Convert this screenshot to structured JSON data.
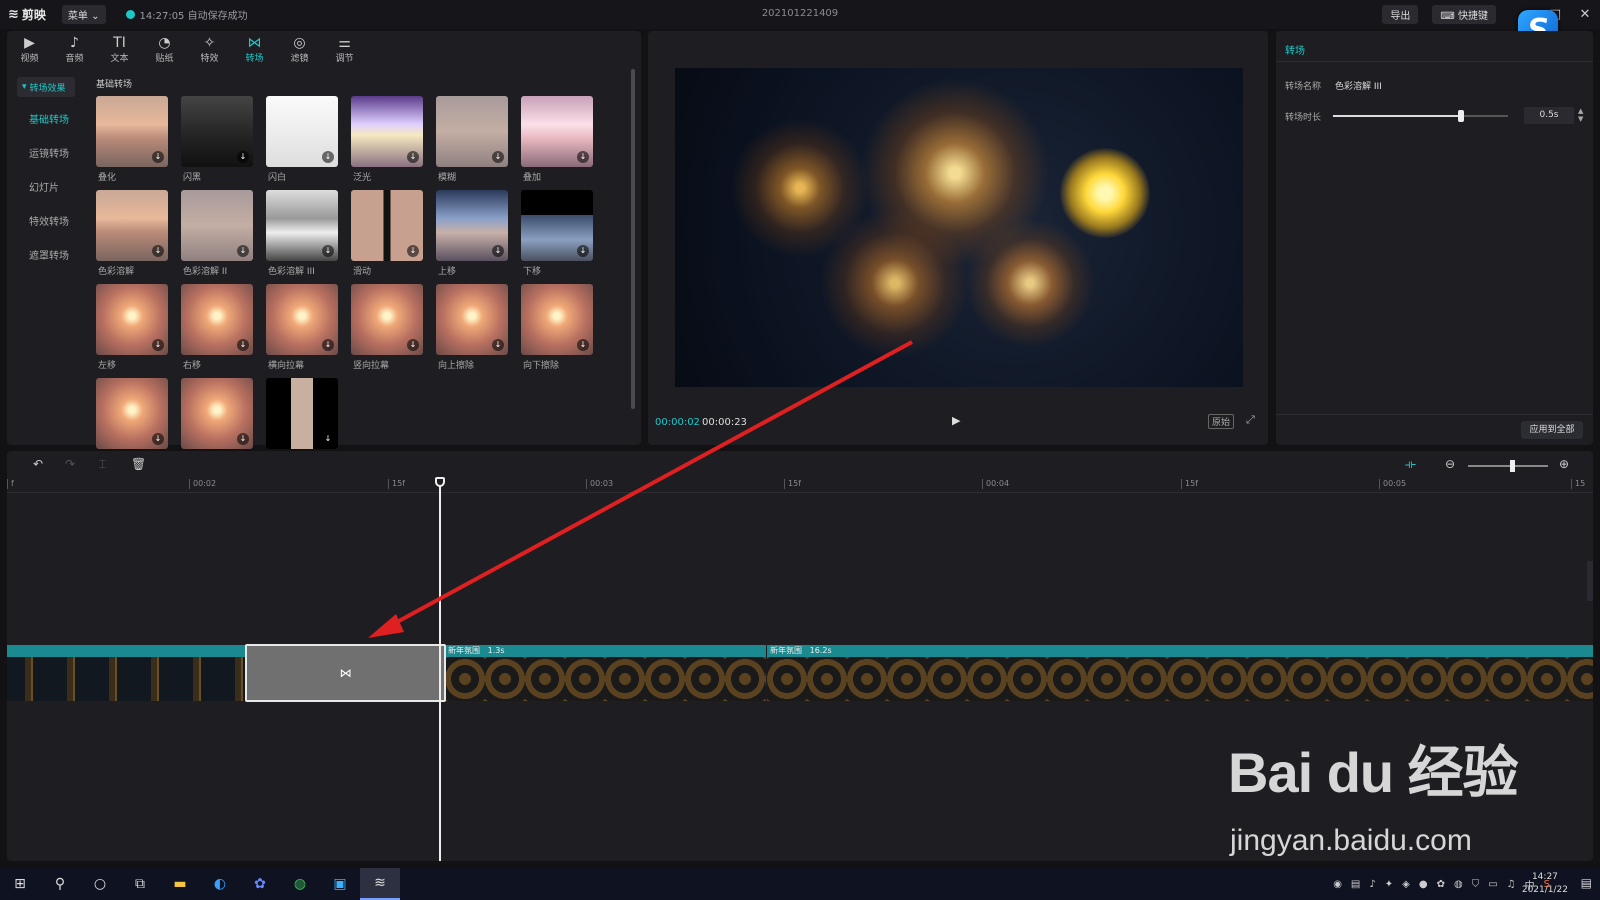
{
  "titlebar": {
    "app_name": "剪映",
    "menu_label": "菜单",
    "save_time": "14:27:05",
    "save_status": "自动保存成功",
    "project_name": "202101221409",
    "export_label": "导出",
    "shortcut_label": "快捷键"
  },
  "toolbar": {
    "tools": [
      {
        "label": "视频",
        "icon": "video-icon"
      },
      {
        "label": "音频",
        "icon": "audio-icon"
      },
      {
        "label": "文本",
        "icon": "text-icon"
      },
      {
        "label": "贴纸",
        "icon": "sticker-icon"
      },
      {
        "label": "特效",
        "icon": "effect-icon"
      },
      {
        "label": "转场",
        "icon": "transition-icon",
        "active": true
      },
      {
        "label": "滤镜",
        "icon": "filter-icon"
      },
      {
        "label": "调节",
        "icon": "adjust-icon"
      }
    ]
  },
  "sidebar": {
    "section": "转场效果",
    "items": [
      "基础转场",
      "运镜转场",
      "幻灯片",
      "特效转场",
      "遮罩转场"
    ],
    "active_index": 0
  },
  "grid": {
    "heading": "基础转场",
    "items": [
      {
        "label": "叠化",
        "style": "t-sunset"
      },
      {
        "label": "闪黑",
        "style": "t-dark"
      },
      {
        "label": "闪白",
        "style": "t-white"
      },
      {
        "label": "泛光",
        "style": "t-glow"
      },
      {
        "label": "模糊",
        "style": "t-blur"
      },
      {
        "label": "叠加",
        "style": "t-pink"
      },
      {
        "label": "色彩溶解",
        "style": "t-sunset"
      },
      {
        "label": "色彩溶解 II",
        "style": "t-blur"
      },
      {
        "label": "色彩溶解 III",
        "style": "t-bw"
      },
      {
        "label": "滑动",
        "style": "t-split"
      },
      {
        "label": "上移",
        "style": "t-blue"
      },
      {
        "label": "下移",
        "style": "t-topblack"
      },
      {
        "label": "左移",
        "style": "t-gold"
      },
      {
        "label": "右移",
        "style": "t-gold"
      },
      {
        "label": "横向拉幕",
        "style": "t-gold"
      },
      {
        "label": "竖向拉幕",
        "style": "t-gold"
      },
      {
        "label": "向上擦除",
        "style": "t-gold"
      },
      {
        "label": "向下擦除",
        "style": "t-gold"
      },
      {
        "label": "",
        "style": "t-gold"
      },
      {
        "label": "",
        "style": "t-gold"
      },
      {
        "label": "",
        "style": "t-blackbars"
      }
    ]
  },
  "preview": {
    "current_time": "00:00:02",
    "total_time": "00:00:23",
    "original_label": "原始"
  },
  "props": {
    "title": "转场",
    "name_label": "转场名称",
    "name_value": "色彩溶解 III",
    "duration_label": "转场时长",
    "duration_value": "0.5s",
    "duration_fraction": 0.73,
    "apply_all_label": "应用到全部"
  },
  "timeline": {
    "zoom_fraction": 0.55,
    "ticks": [
      {
        "label": "f",
        "frac": 0.0
      },
      {
        "label": "00:02",
        "frac": 0.115
      },
      {
        "label": "15f",
        "frac": 0.24
      },
      {
        "label": "00:03",
        "frac": 0.365
      },
      {
        "label": "15f",
        "frac": 0.49
      },
      {
        "label": "00:04",
        "frac": 0.615
      },
      {
        "label": "15f",
        "frac": 0.74
      },
      {
        "label": "00:05",
        "frac": 0.865
      },
      {
        "label": "15",
        "frac": 0.99
      }
    ],
    "clips": [
      {
        "name": "",
        "duration": ""
      },
      {
        "name": "新年氛围",
        "duration": "1.3s"
      },
      {
        "name": "新年氛围",
        "duration": "16.2s"
      }
    ],
    "transition_icon": "bowtie-transition-icon"
  },
  "taskbar": {
    "time": "14:27",
    "date": "2021/1/22",
    "ime": "中"
  },
  "watermark": {
    "main": "Bai du 经验",
    "sub": "jingyan.baidu.com"
  }
}
